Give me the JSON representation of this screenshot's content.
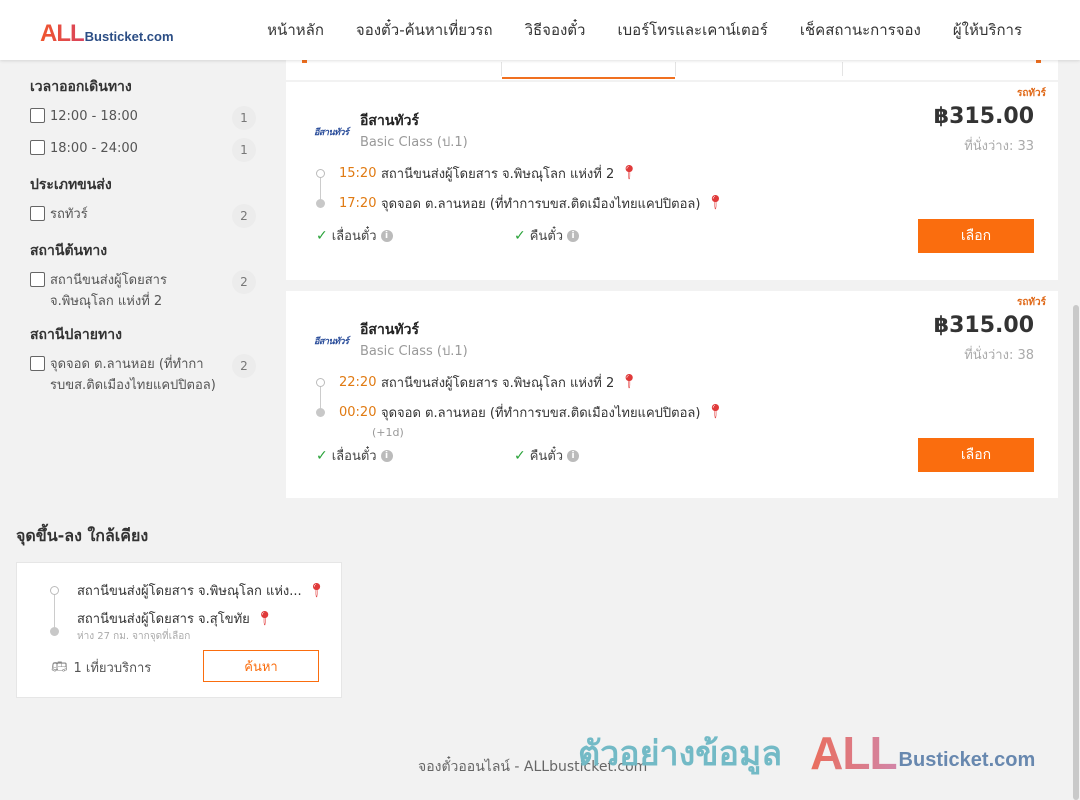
{
  "header": {
    "logo_all": "ALL",
    "logo_rest": "Busticket.com",
    "nav": [
      {
        "label": "หน้าหลัก"
      },
      {
        "label": "จองตั๋ว-ค้นหาเที่ยวรถ"
      },
      {
        "label": "วิธีจองตั๋ว"
      },
      {
        "label": "เบอร์โทรและเคาน์เตอร์"
      },
      {
        "label": "เช็คสถานะการจอง"
      },
      {
        "label": "ผู้ให้บริการ"
      }
    ]
  },
  "filters": {
    "departure": {
      "title": "เวลาออกเดินทาง",
      "items": [
        {
          "label": "12:00 - 18:00",
          "count": "1"
        },
        {
          "label": "18:00 - 24:00",
          "count": "1"
        }
      ]
    },
    "transport": {
      "title": "ประเภทขนส่ง",
      "items": [
        {
          "label": "รถทัวร์",
          "count": "2"
        }
      ]
    },
    "origin": {
      "title": "สถานีต้นทาง",
      "items": [
        {
          "label": "สถานีขนส่งผู้โดยสาร จ.พิษณุโลก แห่งที่ 2",
          "count": "2"
        }
      ]
    },
    "destination": {
      "title": "สถานีปลายทาง",
      "items": [
        {
          "label": "จุดจอด ต.ลานหอย (ที่ทำการบขส.ติดเมืองไทยแคปปิตอล)",
          "count": "2"
        }
      ]
    }
  },
  "trips": [
    {
      "tag": "รถทัวร์",
      "logo": "อีสานทัวร์",
      "operator": "อีสานทัวร์",
      "class": "Basic Class (ป.1)",
      "price": "฿315.00",
      "seats": "ที่นั่งว่าง: 33",
      "dep_time": "15:20",
      "dep_place": "สถานีขนส่งผู้โดยสาร จ.พิษณุโลก แห่งที่ 2",
      "arr_time": "17:20",
      "arr_place": "จุดจอด ต.ลานหอย (ที่ทำการบขส.ติดเมืองไทยแคปปิตอล)",
      "feature1": "เลื่อนตั๋ว",
      "feature2": "คืนตั๋ว",
      "button": "เลือก"
    },
    {
      "tag": "รถทัวร์",
      "logo": "อีสานทัวร์",
      "operator": "อีสานทัวร์",
      "class": "Basic Class (ป.1)",
      "price": "฿315.00",
      "seats": "ที่นั่งว่าง: 38",
      "dep_time": "22:20",
      "dep_place": "สถานีขนส่งผู้โดยสาร จ.พิษณุโลก แห่งที่ 2",
      "arr_time": "00:20",
      "arr_note": "(+1d)",
      "arr_place": "จุดจอด ต.ลานหอย (ที่ทำการบขส.ติดเมืองไทยแคปปิตอล)",
      "feature1": "เลื่อนตั๋ว",
      "feature2": "คืนตั๋ว",
      "button": "เลือก"
    }
  ],
  "nearby": {
    "title": "จุดขึ้น-ลง ใกล้เคียง",
    "from": "สถานีขนส่งผู้โดยสาร จ.พิษณุโลก แห่ง...",
    "to": "สถานีขนส่งผู้โดยสาร จ.สุโขทัย",
    "distance": "ห่าง 27 กม. จากจุดที่เลือก",
    "trips": "1 เที่ยวบริการ",
    "button": "ค้นหา"
  },
  "footer": {
    "text": "จองตั๋วออนไลน์ - ALLbusticket.com"
  },
  "watermark": {
    "text": "ตัวอย่างข้อมูล",
    "all": "ALL",
    "rest": "Busticket.com"
  },
  "colors": {
    "accent": "#fa6d0e",
    "time": "#e07a12",
    "check": "#2aa33a",
    "pin": "#e03a3a"
  },
  "icons": [
    "map-pin-icon",
    "check-icon",
    "info-icon",
    "bus-icon"
  ]
}
